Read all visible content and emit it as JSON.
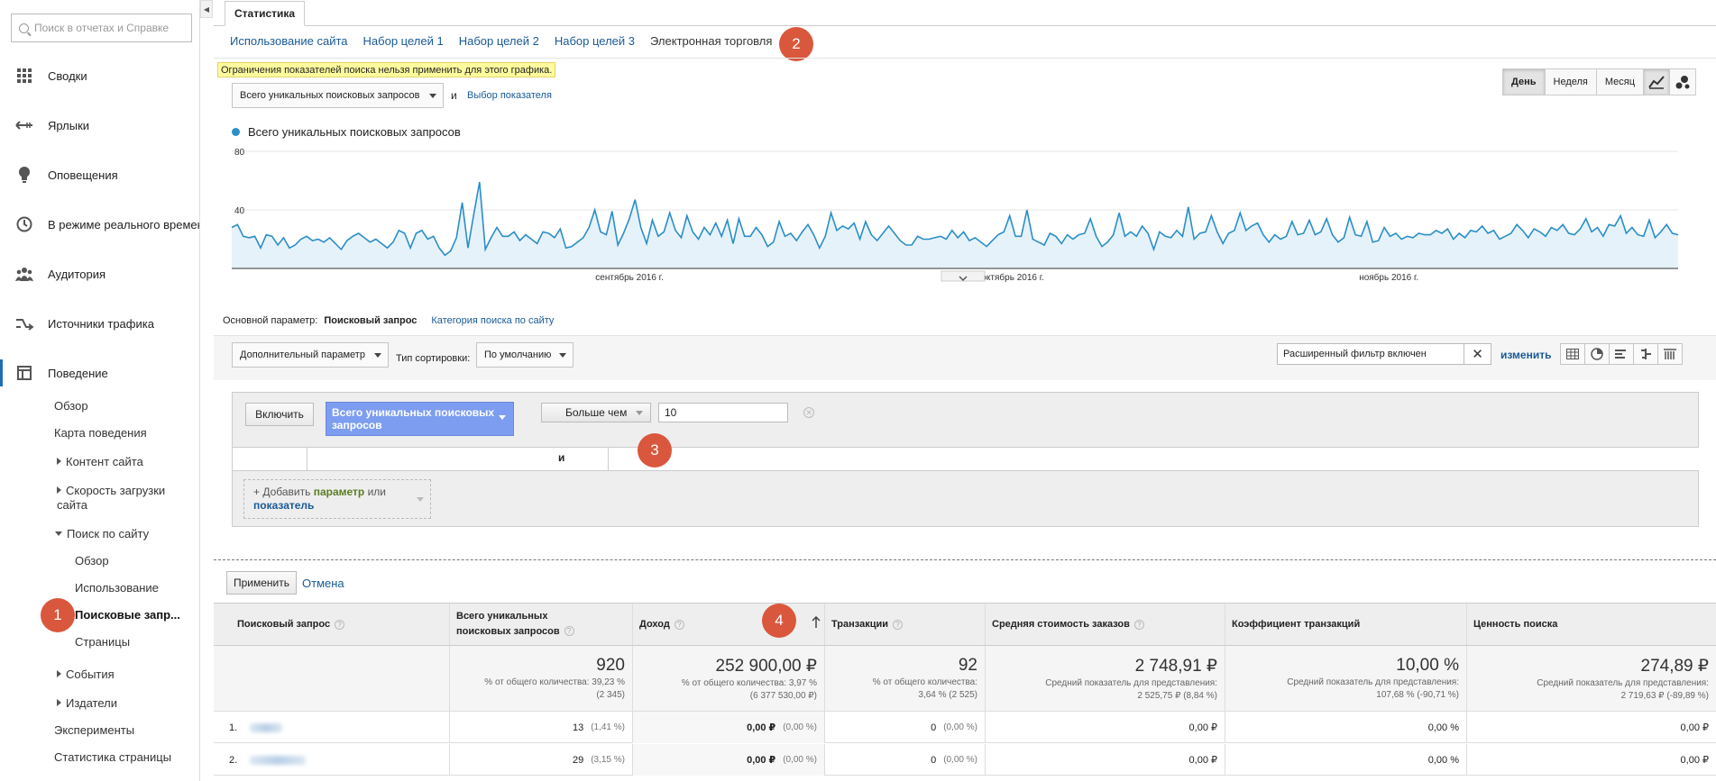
{
  "search": {
    "placeholder": "Поиск в отчетах и Справке"
  },
  "sidebar": {
    "main": [
      {
        "label": "Сводки"
      },
      {
        "label": "Ярлыки"
      },
      {
        "label": "Оповещения"
      },
      {
        "label": "В режиме реального времени"
      },
      {
        "label": "Аудитория"
      },
      {
        "label": "Источники трафика"
      },
      {
        "label": "Поведение"
      }
    ],
    "behavior": {
      "overview": "Обзор",
      "flow": "Карта поведения",
      "content": "Контент сайта",
      "speed": "Скорость загрузки сайта",
      "site_search": "Поиск по сайту",
      "ss_overview": "Обзор",
      "ss_usage": "Использование",
      "ss_terms": "Поисковые запр...",
      "ss_pages": "Страницы",
      "events": "События",
      "publishers": "Издатели",
      "experiments": "Эксперименты",
      "page_stats": "Статистика страницы"
    }
  },
  "badges": {
    "b1": "1",
    "b2": "2",
    "b3": "3",
    "b4": "4"
  },
  "top_tab": "Статистика",
  "subtabs": [
    "Использование сайта",
    "Набор целей 1",
    "Набор целей 2",
    "Набор целей 3",
    "Электронная торговля"
  ],
  "warning": "Ограничения показателей поиска нельзя применить для этого графика.",
  "metric_selector": {
    "value": "Всего уникальных поисковых запросов",
    "and": "и",
    "pick": "Выбор показателя"
  },
  "period": {
    "day": "День",
    "week": "Неделя",
    "month": "Месяц"
  },
  "legend": {
    "series": "Всего уникальных поисковых запросов",
    "color": "#2a8ec7"
  },
  "chart_data": {
    "type": "area",
    "yticks": [
      "80",
      "40"
    ],
    "ylim": [
      0,
      80
    ],
    "xlabels": [
      "сентябрь 2016 г.",
      "октябрь 2016 г.",
      "ноябрь 2016 г."
    ],
    "series": [
      {
        "name": "Всего уникальных поисковых запросов",
        "values": [
          28,
          30,
          22,
          21,
          22,
          14,
          23,
          22,
          16,
          21,
          14,
          16,
          20,
          22,
          19,
          20,
          18,
          21,
          17,
          13,
          19,
          22,
          24,
          21,
          18,
          20,
          17,
          14,
          18,
          26,
          24,
          14,
          24,
          26,
          20,
          22,
          14,
          9,
          12,
          21,
          45,
          14,
          37,
          59,
          13,
          21,
          28,
          22,
          22,
          25,
          19,
          23,
          20,
          17,
          25,
          24,
          21,
          27,
          14,
          15,
          18,
          21,
          28,
          40,
          25,
          23,
          39,
          16,
          24,
          34,
          47,
          28,
          17,
          33,
          22,
          25,
          38,
          26,
          21,
          36,
          25,
          20,
          28,
          23,
          31,
          22,
          33,
          17,
          34,
          22,
          22,
          28,
          23,
          15,
          18,
          32,
          22,
          24,
          19,
          25,
          30,
          23,
          14,
          22,
          38,
          26,
          29,
          27,
          31,
          20,
          32,
          23,
          19,
          24,
          29,
          24,
          19,
          16,
          16,
          22,
          20,
          20,
          21,
          22,
          20,
          26,
          21,
          25,
          19,
          21,
          18,
          15,
          19,
          23,
          25,
          36,
          22,
          22,
          40,
          20,
          18,
          16,
          24,
          22,
          17,
          23,
          20,
          23,
          24,
          34,
          22,
          15,
          18,
          23,
          38,
          22,
          25,
          22,
          29,
          24,
          13,
          25,
          22,
          21,
          26,
          22,
          42,
          20,
          24,
          25,
          36,
          25,
          17,
          24,
          26,
          38,
          26,
          29,
          31,
          23,
          18,
          23,
          20,
          22,
          32,
          23,
          24,
          33,
          23,
          25,
          34,
          23,
          18,
          21,
          35,
          23,
          22,
          32,
          18,
          19,
          28,
          22,
          24,
          20,
          22,
          21,
          24,
          23,
          23,
          26,
          24,
          27,
          20,
          24,
          21,
          26,
          25,
          29,
          24,
          26,
          20,
          22,
          24,
          30,
          26,
          21,
          27,
          25,
          22,
          28,
          26,
          30,
          24,
          23,
          27,
          34,
          25,
          28,
          22,
          30,
          29,
          36,
          24,
          28,
          23,
          22,
          33,
          21,
          25,
          30,
          24,
          23
        ]
      }
    ]
  },
  "dimension": {
    "label": "Основной параметр:",
    "current": "Поисковый запрос",
    "other": "Категория поиска по сайту"
  },
  "toolbar": {
    "secondary": "Дополнительный параметр",
    "sort_label": "Тип сортировки:",
    "sort_value": "По умолчанию",
    "filter": "Расширенный фильтр включен",
    "change": "изменить"
  },
  "filter": {
    "include": "Включить",
    "metric": "Всего уникальных поисковых запросов",
    "comparator": "Больше чем",
    "value": "10",
    "and": "и",
    "add_prefix": "+ Добавить",
    "add_param": "параметр",
    "add_or": "или",
    "add_metric": "показатель"
  },
  "apply": "Применить",
  "cancel": "Отмена",
  "table": {
    "headers": [
      "Поисковый запрос",
      "Всего уникальных поисковых запросов",
      "Доход",
      "Транзакции",
      "Средняя стоимость заказов",
      "Коэффициент транзакций",
      "Ценность поиска"
    ],
    "totals": [
      {
        "big": "",
        "sm1": "",
        "sm2": ""
      },
      {
        "big": "920",
        "sm1": "% от общего количества: 39,23 %",
        "sm2": "(2 345)"
      },
      {
        "big": "252 900,00 ₽",
        "sm1": "% от общего количества: 3,97 %",
        "sm2": "(6 377 530,00 ₽)"
      },
      {
        "big": "92",
        "sm1": "% от общего количества:",
        "sm2": "3,64 % (2 525)"
      },
      {
        "big": "2 748,91 ₽",
        "sm1": "Средний показатель для представления:",
        "sm2": "2 525,75 ₽ (8,84 %)"
      },
      {
        "big": "10,00 %",
        "sm1": "Средний показатель для представления:",
        "sm2": "107,68 % (-90,71 %)"
      },
      {
        "big": "274,89 ₽",
        "sm1": "Средний показатель для представления:",
        "sm2": "2 719,63 ₽ (-89,89 %)"
      }
    ],
    "rows": [
      {
        "n": "1.",
        "searches": "13",
        "searches_pct": "(1,41 %)",
        "revenue": "0,00 ₽",
        "revenue_pct": "(0,00 %)",
        "tx": "0",
        "tx_pct": "(0,00 %)",
        "aov": "0,00 ₽",
        "rate": "0,00 %",
        "value": "0,00 ₽"
      },
      {
        "n": "2.",
        "searches": "29",
        "searches_pct": "(3,15 %)",
        "revenue": "0,00 ₽",
        "revenue_pct": "(0,00 %)",
        "tx": "0",
        "tx_pct": "(0,00 %)",
        "aov": "0,00 ₽",
        "rate": "0,00 %",
        "value": "0,00 ₽"
      }
    ]
  }
}
